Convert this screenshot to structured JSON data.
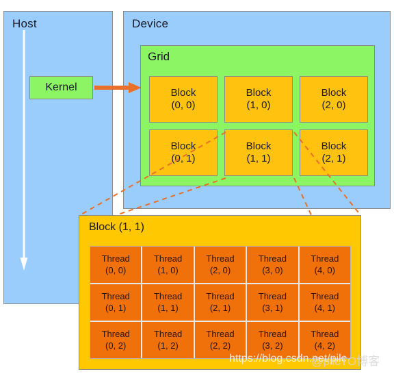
{
  "host": {
    "title": "Host",
    "kernel_label": "Kernel",
    "down_arrow_icon": "arrow-down-icon"
  },
  "device": {
    "title": "Device",
    "kernel_launch_arrow_icon": "arrow-right-icon",
    "grid": {
      "title": "Grid",
      "blocks": [
        {
          "name": "Block",
          "index": "(0, 0)"
        },
        {
          "name": "Block",
          "index": "(1, 0)"
        },
        {
          "name": "Block",
          "index": "(2, 0)"
        },
        {
          "name": "Block",
          "index": "(0, 1)"
        },
        {
          "name": "Block",
          "index": "(1, 1)"
        },
        {
          "name": "Block",
          "index": "(2, 1)"
        }
      ]
    }
  },
  "detail": {
    "title": "Block (1, 1)",
    "threads": [
      {
        "name": "Thread",
        "index": "(0, 0)"
      },
      {
        "name": "Thread",
        "index": "(1, 0)"
      },
      {
        "name": "Thread",
        "index": "(2, 0)"
      },
      {
        "name": "Thread",
        "index": "(3, 0)"
      },
      {
        "name": "Thread",
        "index": "(4, 0)"
      },
      {
        "name": "Thread",
        "index": "(0, 1)"
      },
      {
        "name": "Thread",
        "index": "(1, 1)"
      },
      {
        "name": "Thread",
        "index": "(2, 1)"
      },
      {
        "name": "Thread",
        "index": "(3, 1)"
      },
      {
        "name": "Thread",
        "index": "(4, 1)"
      },
      {
        "name": "Thread",
        "index": "(0, 2)"
      },
      {
        "name": "Thread",
        "index": "(1, 2)"
      },
      {
        "name": "Thread",
        "index": "(2, 2)"
      },
      {
        "name": "Thread",
        "index": "(3, 2)"
      },
      {
        "name": "Thread",
        "index": "(4, 2)"
      }
    ]
  },
  "watermark": {
    "url": "https://blog.csdn.net/pilc",
    "overlay": "@pilcTO博客"
  },
  "colors": {
    "panel_blue": "#9ACDFB",
    "grid_green": "#8CF563",
    "block_orange": "#FFC20E",
    "detail_yellow": "#FFC800",
    "thread_orange": "#F0700A",
    "connector_orange": "#E8702A",
    "arrow_white": "#FFFFFF",
    "border_gray": "#8A8A8A"
  }
}
